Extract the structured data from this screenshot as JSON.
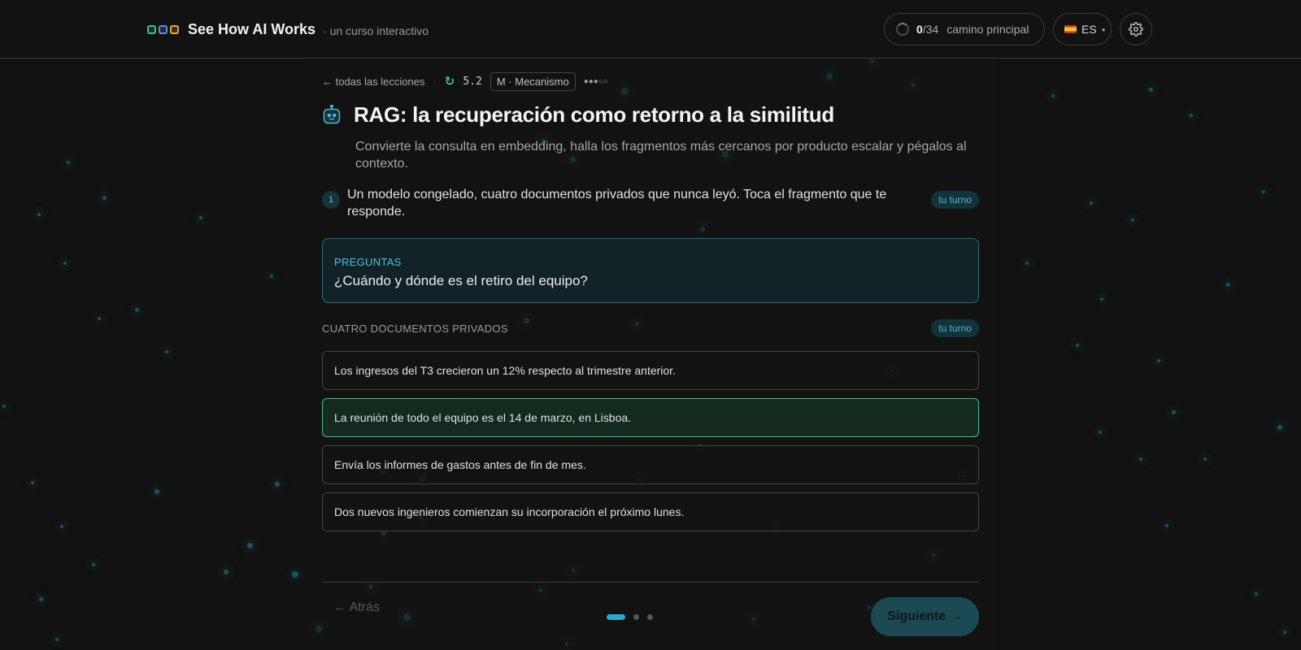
{
  "header": {
    "brand_title": "See How AI Works",
    "brand_sub": "· un curso interactivo",
    "brand_dot_colors": [
      "#3fbf7f",
      "#5a8ee6",
      "#e8a83a"
    ],
    "progress_done": "0",
    "progress_total": "/34",
    "progress_label": "camino principal",
    "language": "ES",
    "settings_icon": "gear-icon"
  },
  "crumbs": {
    "back_link": "← todas las lecciones",
    "separator": "·",
    "lesson_number": "5.2",
    "level": "M · Mecanismo",
    "difficulty": "●●●○○"
  },
  "lesson": {
    "title": "RAG: la recuperación como retorno a la similitud",
    "subtitle": "Convierte la consulta en embedding, halla los fragmentos más cercanos por producto escalar y pégalos al contexto."
  },
  "step": {
    "number": "1",
    "text": "Un modelo congelado, cuatro documentos privados que nunca leyó. Toca el fragmento que te responde.",
    "badge": "tu turno"
  },
  "question": {
    "label": "PREGUNTAS",
    "text": "¿Cuándo y dónde es el retiro del equipo?"
  },
  "documents": {
    "label": "CUATRO DOCUMENTOS PRIVADOS",
    "badge": "tu turno",
    "items": [
      "Los ingresos del T3 crecieron un 12% respecto al trimestre anterior.",
      "La reunión de todo el equipo es el 14 de marzo, en Lisboa.",
      "Envía los informes de gastos antes de fin de mes.",
      "Dos nuevos ingenieros comienzan su incorporación el próximo lunes."
    ],
    "selected_index": 1
  },
  "footer": {
    "back": "← Atrás",
    "next": "Siguiente →",
    "pages": 3,
    "current_page": 1
  },
  "colors": {
    "accent": "#2aa8cf",
    "selected": "#3fbf7f",
    "background": "#111111"
  }
}
